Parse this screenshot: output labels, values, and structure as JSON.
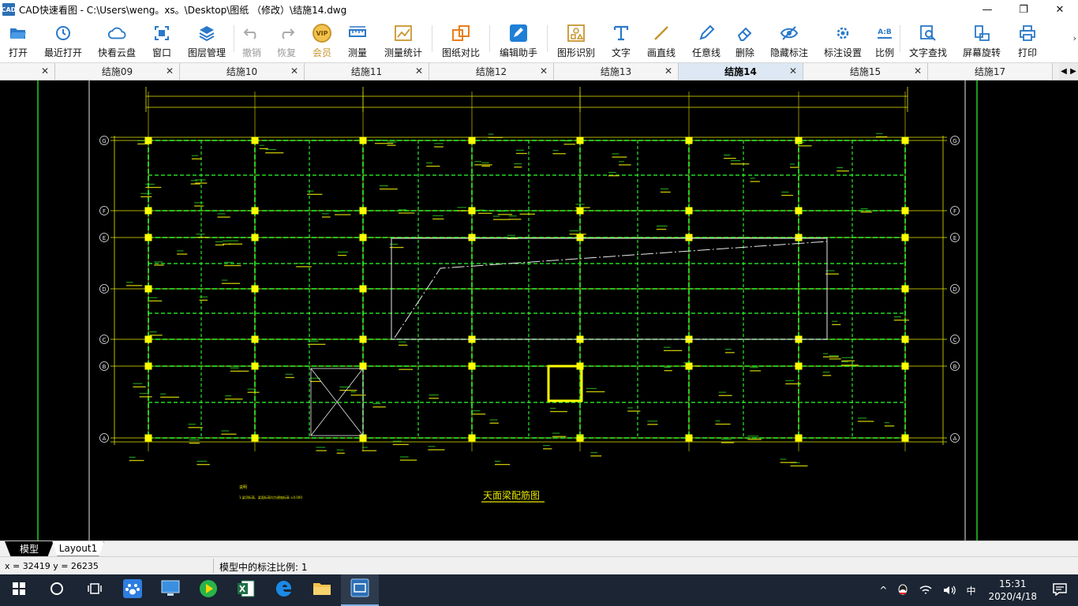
{
  "window": {
    "app_icon": "CAD",
    "title": "CAD快速看图 - C:\\Users\\weng。xs。\\Desktop\\图纸 （修改）\\结施14.dwg",
    "controls": {
      "minimize": "—",
      "maximize": "❐",
      "close": "✕"
    }
  },
  "toolbar": {
    "items": [
      {
        "label": "打开",
        "icon": "folder-open-icon"
      },
      {
        "label": "最近打开",
        "icon": "recent-clock-icon"
      },
      {
        "label": "快看云盘",
        "icon": "cloud-icon"
      },
      {
        "label": "窗口",
        "icon": "window-frame-icon"
      },
      {
        "label": "图层管理",
        "icon": "layers-icon"
      },
      {
        "label": "撤销",
        "icon": "undo-icon"
      },
      {
        "label": "恢复",
        "icon": "redo-icon"
      },
      {
        "label": "会员",
        "icon": "vip-badge-icon"
      },
      {
        "label": "测量",
        "icon": "ruler-icon"
      },
      {
        "label": "测量统计",
        "icon": "measure-stats-icon"
      },
      {
        "label": "图纸对比",
        "icon": "compare-icon"
      },
      {
        "label": "编辑助手",
        "icon": "edit-assistant-icon"
      },
      {
        "label": "图形识别",
        "icon": "shape-recognize-icon"
      },
      {
        "label": "文字",
        "icon": "text-t-icon"
      },
      {
        "label": "画直线",
        "icon": "line-icon"
      },
      {
        "label": "任意线",
        "icon": "pen-icon"
      },
      {
        "label": "删除",
        "icon": "eraser-icon"
      },
      {
        "label": "隐藏标注",
        "icon": "eye-hide-icon"
      },
      {
        "label": "标注设置",
        "icon": "gear-icon"
      },
      {
        "label": "比例",
        "icon": "scale-ab-icon"
      },
      {
        "label": "文字查找",
        "icon": "text-search-icon"
      },
      {
        "label": "屏幕旋转",
        "icon": "rotate-screen-icon"
      },
      {
        "label": "打印",
        "icon": "printer-icon"
      }
    ],
    "vip_text": "VIP",
    "ab_text": "A:B",
    "more": "›"
  },
  "tabs": {
    "items": [
      {
        "label": ""
      },
      {
        "label": "结施09"
      },
      {
        "label": "结施10"
      },
      {
        "label": "结施11"
      },
      {
        "label": "结施12"
      },
      {
        "label": "结施13"
      },
      {
        "label": "结施14",
        "active": true
      },
      {
        "label": "结施15"
      },
      {
        "label": "结施17"
      }
    ],
    "close": "✕",
    "nav_left": "◀",
    "nav_right": "▶"
  },
  "drawing": {
    "title": "天面梁配筋图",
    "axis_labels": [
      "G",
      "F",
      "E",
      "D",
      "C",
      "B",
      "A"
    ],
    "note_heading": "说明",
    "note_text": "1.梁顶标高、梁面标高均为建施标高 ±0.000"
  },
  "layouts": {
    "model": "模型",
    "layout1": "Layout1"
  },
  "status": {
    "coords": "x = 32419  y = 26235",
    "scale": "模型中的标注比例: 1"
  },
  "taskbar": {
    "ime": "中",
    "time": "15:31",
    "date": "2020/4/18",
    "tray_up": "^"
  },
  "colors": {
    "canvas_bg": "#000000",
    "beam_green": "#2dff2d",
    "grid_yellow": "#e8e800",
    "column_yellow": "#ffff00",
    "taskbar_bg": "#1b2533",
    "active_tab": "#dde8f4"
  }
}
